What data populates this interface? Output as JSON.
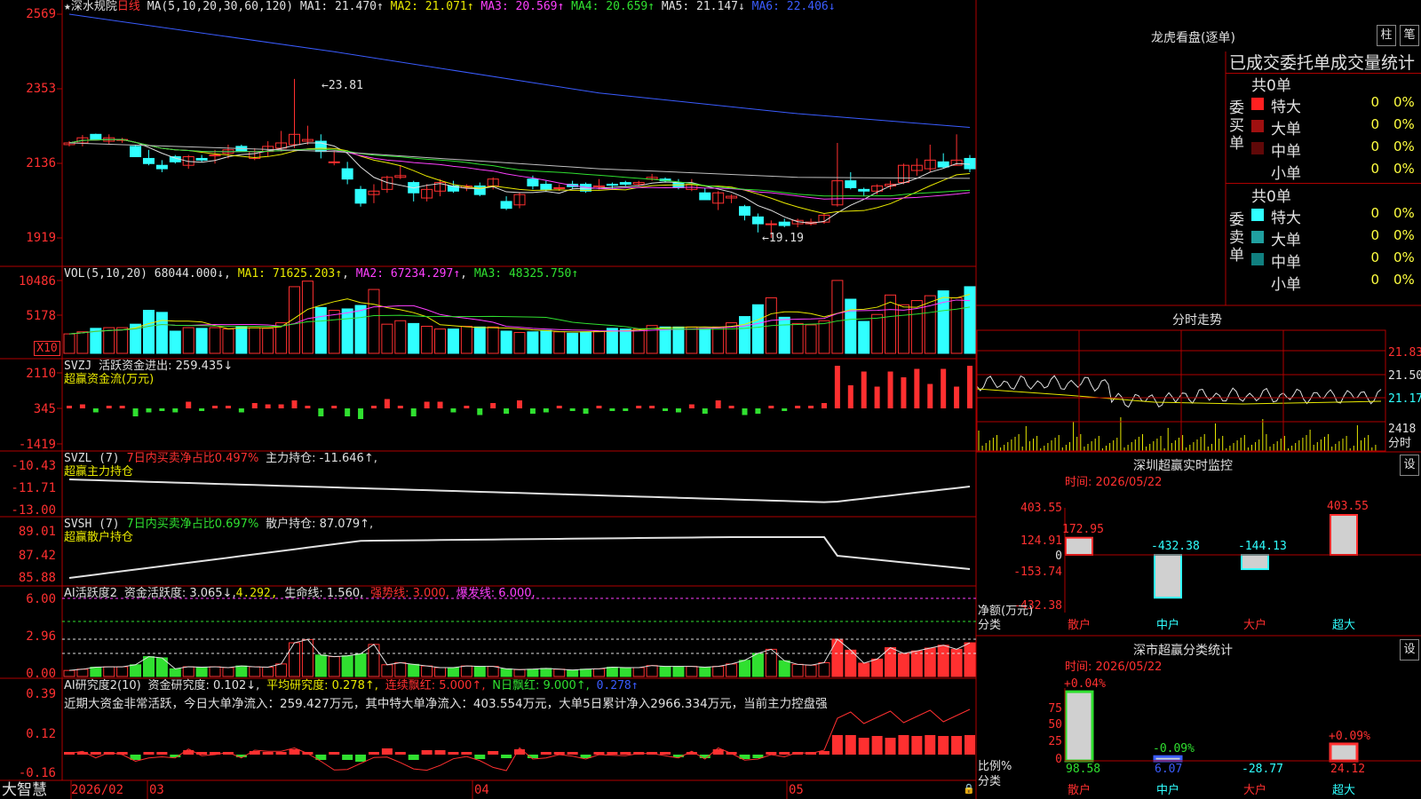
{
  "colors": {
    "up": "#ff3030",
    "down": "#30ffff",
    "grid": "#b00000",
    "ma1": "#e0e0e0",
    "ma2": "#e8e800",
    "ma3": "#ff40ff",
    "ma4": "#30e030",
    "ma5": "#c0c0c0",
    "ma6": "#3a5cff"
  },
  "main": {
    "star": "★",
    "stock_name": "深水规院",
    "period": "日线",
    "ma_params": "MA(5,10,20,30,60,120)",
    "ma1": "MA1: 21.470↑",
    "ma2": "MA2: 21.071↑",
    "ma3": "MA3: 20.569↑",
    "ma4": "MA4: 20.659↑",
    "ma5": "MA5: 21.147↓",
    "ma6": "MA6: 22.406↓",
    "y_labels": [
      "2569",
      "2353",
      "2136",
      "1919"
    ],
    "high_label": "23.81",
    "low_label": "19.19"
  },
  "vol": {
    "title": "VOL(5,10,20)",
    "value": "68044.000↓",
    "ma1": "MA1: 71625.203↑",
    "ma2": "MA2: 67234.297↑",
    "ma3": "MA3: 48325.750↑",
    "y_labels": [
      "10486",
      "5178"
    ],
    "unit": "X10"
  },
  "svzj": {
    "title": "SVZJ",
    "line": "活跃资金进出: 259.435↓",
    "sub": "超赢资金流(万元)",
    "y_labels": [
      "2110",
      "345",
      "-1419"
    ]
  },
  "svzl": {
    "title": "SVZL (7)",
    "ratio": "7日内买卖净占比0.497%",
    "hold": "主力持仓: -11.646↑,",
    "sub": "超赢主力持仓",
    "y_labels": [
      "-10.43",
      "-11.71",
      "-13.00"
    ]
  },
  "svsh": {
    "title": "SVSH (7)",
    "ratio": "7日内买卖净占比0.697%",
    "hold": "散户持仓: 87.079↑,",
    "sub": "超赢散户持仓",
    "y_labels": [
      "89.01",
      "87.42",
      "85.88"
    ]
  },
  "ai2": {
    "title": "AI活跃度2",
    "act": "资金活跃度: 3.065↓,",
    "act2": "4.292,",
    "life": "生命线: 1.560,",
    "strong": "强势线: 3.000,",
    "burst": "爆发线: 6.000,",
    "y_labels": [
      "6.00",
      "2.96",
      "0.00"
    ]
  },
  "ai_research": {
    "title": "AI研究度2(10)",
    "research": "资金研究度: 0.102↓,",
    "avg": "平均研究度: 0.278↑,",
    "cont": "连续飘红: 5.000↑,",
    "nday": "N日飘红: 9.000↑,",
    "last": "0.278↑",
    "summary": "近期大资金非常活跃，今日大单净流入：259.427万元，其中特大单净流入：403.554万元，大单5日累计净入2966.334万元，当前主力控盘强",
    "y_labels": [
      "0.39",
      "0.12",
      "-0.16"
    ]
  },
  "xaxis": {
    "logo": "大智慧",
    "labels": [
      "2026/02",
      "03",
      "04",
      "05"
    ]
  },
  "right": {
    "dragon": {
      "title": "龙虎看盘(逐单)",
      "btn1": "柱",
      "btn2": "笔",
      "header": "已成交委托单成交量统计",
      "buy": {
        "label": "委买单",
        "total": "共0单",
        "rows": [
          {
            "name": "特大",
            "v1": "0",
            "v2": "0%",
            "color": "#ff2020"
          },
          {
            "name": "大单",
            "v1": "0",
            "v2": "0%",
            "color": "#a01010"
          },
          {
            "name": "中单",
            "v1": "0",
            "v2": "0%",
            "color": "#600808"
          },
          {
            "name": "小单",
            "v1": "0",
            "v2": "0%",
            "color": "#000000"
          }
        ]
      },
      "sell": {
        "label": "委卖单",
        "total": "共0单",
        "rows": [
          {
            "name": "特大",
            "v1": "0",
            "v2": "0%",
            "color": "#30ffff"
          },
          {
            "name": "大单",
            "v1": "0",
            "v2": "0%",
            "color": "#20a0a0"
          },
          {
            "name": "中单",
            "v1": "0",
            "v2": "0%",
            "color": "#108080"
          },
          {
            "name": "小单",
            "v1": "0",
            "v2": "0%",
            "color": "#000000"
          }
        ]
      }
    },
    "fenshi": {
      "title": "分时走势",
      "y_labels": [
        "21.83",
        "21.50",
        "21.17",
        "2418"
      ],
      "unit": "分时"
    },
    "monitor": {
      "title": "深圳超赢实时监控",
      "btn": "设",
      "time": "时间: 2026/05/22",
      "y_labels": [
        "403.55",
        "124.91",
        "0",
        "-153.74",
        "-432.38"
      ],
      "net_label": "净额(万元)",
      "cat_label": "分类",
      "bars": [
        {
          "name": "散户",
          "value": 172.95,
          "label": "172.95"
        },
        {
          "name": "中户",
          "value": -432.38,
          "label": "-432.38"
        },
        {
          "name": "大户",
          "value": -144.13,
          "label": "-144.13"
        },
        {
          "name": "超大",
          "value": 403.55,
          "label": "403.55"
        }
      ]
    },
    "stats": {
      "title": "深市超赢分类统计",
      "btn": "设",
      "time": "时间: 2026/05/22",
      "y_labels": [
        "75",
        "50",
        "25",
        "0"
      ],
      "ratio_label": "比例%",
      "cat_label": "分类",
      "bars": [
        {
          "name": "散户",
          "pct": 0.04,
          "top": "+0.04%",
          "bottom": "98.58",
          "fill": 98.58
        },
        {
          "name": "中户",
          "pct": -0.09,
          "top": "-0.09%",
          "bottom": "6.07",
          "fill": 6.07
        },
        {
          "name": "大户",
          "pct": 0,
          "top": "",
          "bottom": "-28.77",
          "fill": 0
        },
        {
          "name": "超大",
          "pct": 0.09,
          "top": "+0.09%",
          "bottom": "24.12",
          "fill": 24.12
        }
      ]
    }
  },
  "chart_data": {
    "type": "candlestick",
    "series": [
      {
        "name": "日线",
        "values": [
          [
            21.9,
            22.0,
            21.85,
            21.95
          ],
          [
            21.95,
            22.18,
            21.85,
            22.1
          ],
          [
            22.2,
            22.22,
            22.05,
            22.05
          ],
          [
            22.0,
            22.2,
            21.9,
            22.1
          ],
          [
            22.05,
            22.1,
            21.95,
            22.05
          ],
          [
            21.85,
            21.9,
            21.55,
            21.55
          ],
          [
            21.5,
            21.75,
            21.3,
            21.35
          ],
          [
            21.3,
            21.45,
            21.1,
            21.2
          ],
          [
            21.55,
            21.6,
            21.35,
            21.4
          ],
          [
            21.3,
            21.6,
            21.2,
            21.55
          ],
          [
            21.5,
            21.6,
            21.4,
            21.45
          ],
          [
            21.6,
            21.75,
            21.35,
            21.6
          ],
          [
            21.65,
            21.9,
            21.5,
            21.75
          ],
          [
            21.85,
            21.9,
            21.7,
            21.7
          ],
          [
            21.5,
            21.8,
            21.45,
            21.7
          ],
          [
            21.7,
            22.0,
            21.55,
            21.85
          ],
          [
            21.8,
            22.3,
            21.7,
            21.95
          ],
          [
            21.9,
            23.81,
            21.8,
            22.2
          ],
          [
            22.0,
            22.45,
            21.9,
            22.05
          ],
          [
            22.0,
            22.2,
            21.5,
            21.7
          ],
          [
            21.4,
            21.75,
            21.3,
            21.4
          ],
          [
            21.2,
            21.4,
            20.75,
            20.9
          ],
          [
            20.6,
            20.7,
            20.1,
            20.2
          ],
          [
            20.45,
            20.75,
            20.2,
            20.55
          ],
          [
            20.6,
            21.0,
            20.5,
            20.95
          ],
          [
            20.95,
            21.3,
            20.9,
            21.0
          ],
          [
            20.8,
            20.85,
            20.25,
            20.5
          ],
          [
            20.35,
            20.75,
            20.25,
            20.6
          ],
          [
            20.55,
            20.9,
            20.4,
            20.8
          ],
          [
            20.7,
            20.85,
            20.5,
            20.55
          ],
          [
            20.65,
            20.75,
            20.55,
            20.7
          ],
          [
            20.7,
            20.8,
            20.4,
            20.45
          ],
          [
            20.7,
            20.95,
            20.6,
            20.9
          ],
          [
            20.25,
            20.4,
            20.0,
            20.05
          ],
          [
            20.15,
            20.5,
            20.05,
            20.45
          ],
          [
            20.9,
            21.0,
            20.6,
            20.7
          ],
          [
            20.75,
            20.85,
            20.55,
            20.6
          ],
          [
            20.65,
            20.75,
            20.55,
            20.65
          ],
          [
            20.75,
            20.85,
            20.6,
            20.68
          ],
          [
            20.75,
            20.8,
            20.5,
            20.55
          ],
          [
            20.7,
            20.9,
            20.6,
            20.7
          ],
          [
            20.75,
            20.8,
            20.6,
            20.72
          ],
          [
            20.8,
            20.85,
            20.7,
            20.75
          ],
          [
            20.75,
            20.85,
            20.7,
            20.8
          ],
          [
            20.9,
            21.05,
            20.85,
            20.95
          ],
          [
            20.9,
            20.95,
            20.8,
            20.85
          ],
          [
            20.8,
            20.9,
            20.6,
            20.65
          ],
          [
            20.6,
            20.9,
            20.55,
            20.75
          ],
          [
            20.5,
            20.65,
            20.3,
            20.3
          ],
          [
            20.2,
            20.55,
            20.0,
            20.5
          ],
          [
            20.35,
            20.45,
            20.2,
            20.4
          ],
          [
            20.1,
            20.15,
            19.7,
            19.85
          ],
          [
            19.8,
            19.9,
            19.35,
            19.6
          ],
          [
            19.6,
            19.7,
            19.19,
            19.6
          ],
          [
            19.65,
            19.75,
            19.5,
            19.55
          ],
          [
            19.6,
            19.75,
            19.5,
            19.7
          ],
          [
            19.6,
            19.75,
            19.55,
            19.65
          ],
          [
            19.65,
            19.9,
            19.6,
            19.85
          ],
          [
            20.15,
            21.95,
            20.1,
            20.85
          ],
          [
            20.85,
            21.1,
            20.6,
            20.65
          ],
          [
            20.6,
            20.65,
            20.4,
            20.55
          ],
          [
            20.55,
            20.75,
            20.45,
            20.7
          ],
          [
            20.7,
            20.85,
            20.6,
            20.75
          ],
          [
            20.8,
            21.35,
            20.75,
            21.3
          ],
          [
            21.15,
            21.5,
            21.0,
            21.3
          ],
          [
            21.2,
            21.9,
            21.1,
            21.45
          ],
          [
            21.4,
            21.65,
            21.2,
            21.25
          ],
          [
            21.3,
            22.2,
            21.3,
            21.45
          ],
          [
            21.5,
            21.6,
            21.1,
            21.2
          ]
        ]
      }
    ],
    "volume": [
      2800,
      3100,
      3600,
      3700,
      3700,
      4200,
      6200,
      5900,
      3200,
      3700,
      3600,
      3700,
      3500,
      3900,
      3700,
      3600,
      4400,
      9600,
      10400,
      6600,
      6200,
      6400,
      6900,
      9200,
      4200,
      4700,
      4300,
      3900,
      3500,
      3500,
      3900,
      3800,
      3800,
      3200,
      3000,
      3100,
      3300,
      3100,
      2900,
      3100,
      3200,
      3600,
      3500,
      3500,
      4000,
      3800,
      3800,
      3800,
      3600,
      3800,
      4400,
      5300,
      7000,
      8000,
      5200,
      4300,
      4100,
      4700,
      10500,
      7800,
      4600,
      5600,
      8400,
      7000,
      7600,
      8300,
      9000,
      8000,
      9600
    ],
    "ylim": [
      19.19,
      25.69
    ]
  }
}
